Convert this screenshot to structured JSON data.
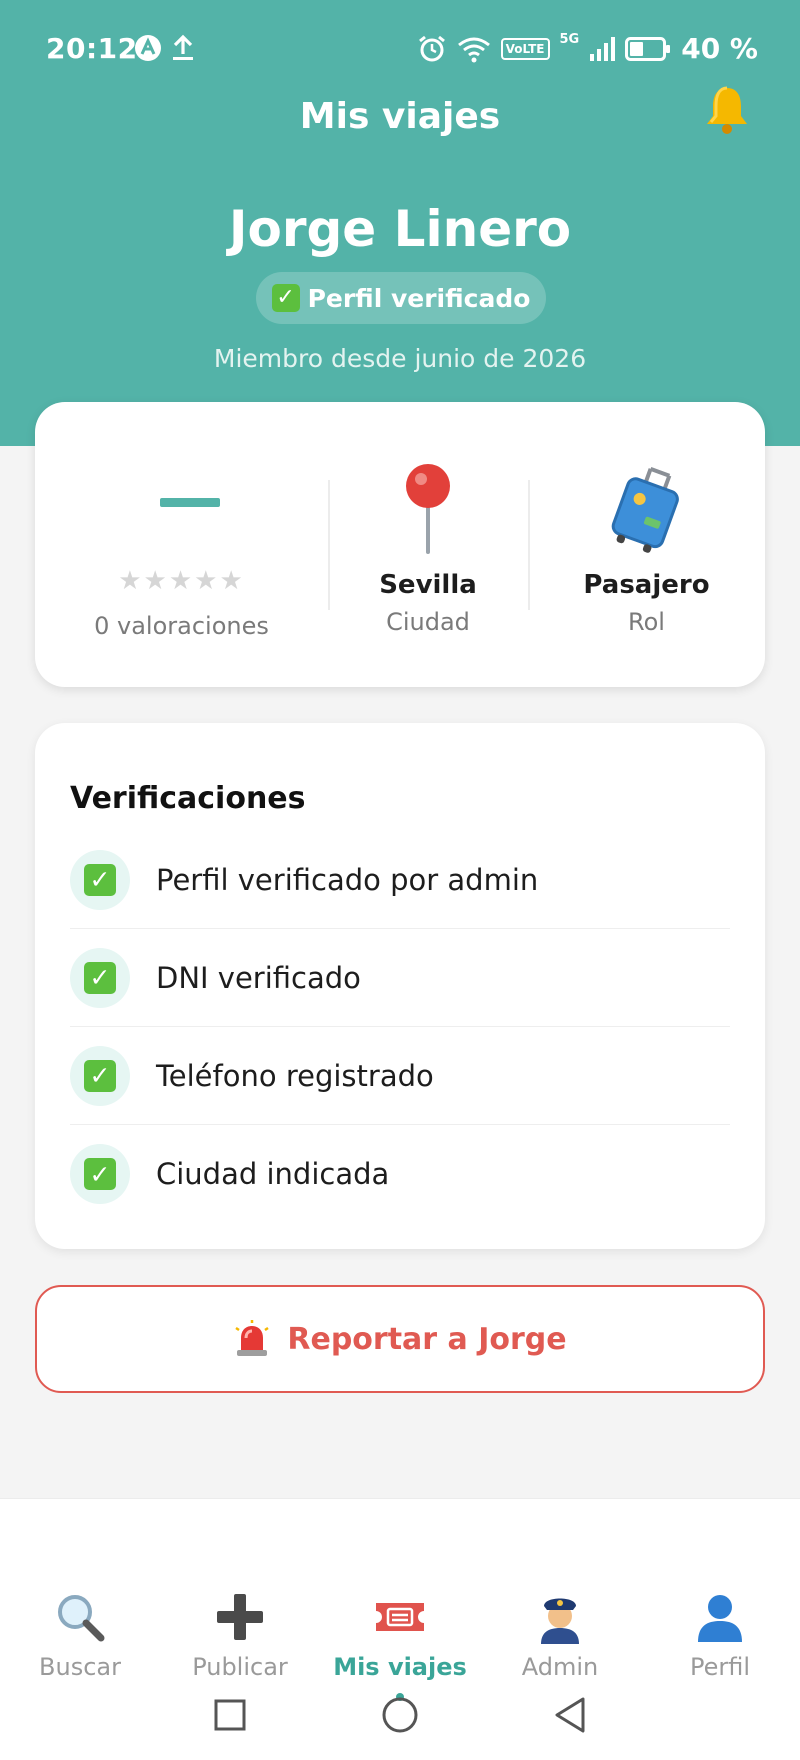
{
  "status_bar": {
    "time": "20:12",
    "volte": "VoLTE",
    "network": "5G",
    "battery": "40 %"
  },
  "header": {
    "title": "Mis viajes",
    "notification_icon": "bell-icon"
  },
  "profile": {
    "name": "Jorge Linero",
    "verified_label": "Perfil verificado",
    "member_since": "Miembro desde junio de 2026"
  },
  "stats": {
    "rating_value": "—",
    "stars": "★★★★★",
    "rating_stars": 0,
    "rating_count": "0 valoraciones",
    "city_value": "Sevilla",
    "city_label": "Ciudad",
    "role_value": "Pasajero",
    "role_label": "Rol"
  },
  "verifications": {
    "title": "Verificaciones",
    "items": [
      {
        "label": "Perfil verificado por admin"
      },
      {
        "label": "DNI verificado"
      },
      {
        "label": "Teléfono registrado"
      },
      {
        "label": "Ciudad indicada"
      }
    ]
  },
  "report": {
    "label": "Reportar a Jorge"
  },
  "bottom_nav": {
    "items": [
      {
        "label": "Buscar",
        "icon": "magnifier-icon"
      },
      {
        "label": "Publicar",
        "icon": "plus-icon"
      },
      {
        "label": "Mis viajes",
        "icon": "ticket-icon",
        "active": true
      },
      {
        "label": "Admin",
        "icon": "police-officer-icon"
      },
      {
        "label": "Perfil",
        "icon": "person-icon"
      }
    ]
  },
  "colors": {
    "primary": "#53b3a8",
    "accent": "#3aa598",
    "danger": "#e05a52",
    "verified": "#5cbf3e"
  }
}
